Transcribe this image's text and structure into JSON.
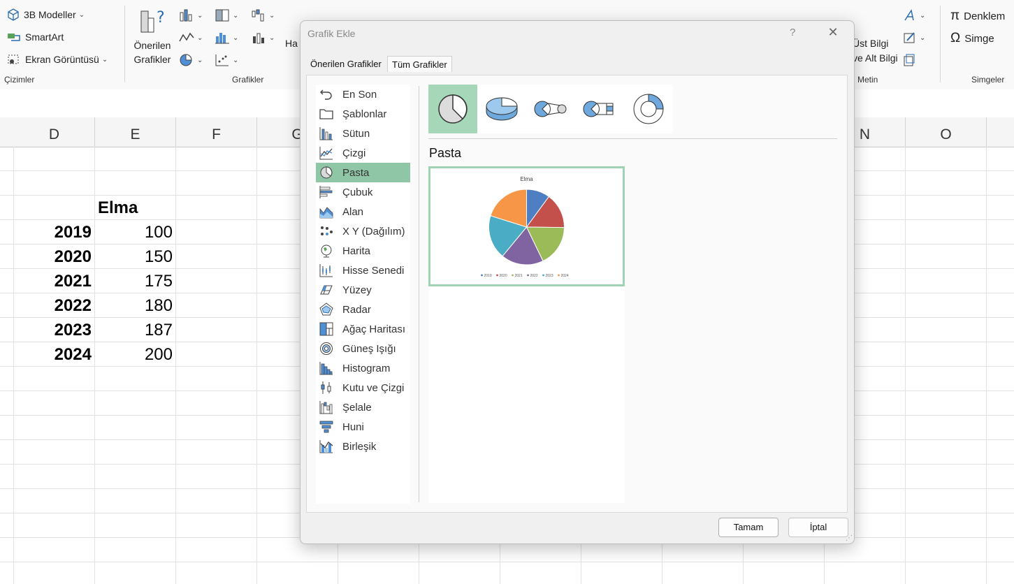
{
  "ribbon": {
    "models_3d": "3B Modeller",
    "smartart": "SmartArt",
    "screenshot": "Ekran Görüntüsü",
    "group_drawings": "Çizimler",
    "recommended_l1": "Önerilen",
    "recommended_l2": "Grafikler",
    "group_charts": "Grafikler",
    "map_partial": "Ha",
    "header_l1": "Üst Bilgi",
    "header_l2": "ve Alt Bilgi",
    "group_text": "Metin",
    "equation": "Denklem",
    "symbol": "Simge",
    "group_symbols": "Simgeler"
  },
  "sheet": {
    "columns": [
      "D",
      "E",
      "F",
      "G",
      "N",
      "O"
    ],
    "header_label": "Elma",
    "rows": [
      {
        "year": "2019",
        "value": "100"
      },
      {
        "year": "2020",
        "value": "150"
      },
      {
        "year": "2021",
        "value": "175"
      },
      {
        "year": "2022",
        "value": "180"
      },
      {
        "year": "2023",
        "value": "187"
      },
      {
        "year": "2024",
        "value": "200"
      }
    ]
  },
  "dialog": {
    "title": "Grafik Ekle",
    "help": "?",
    "close": "✕",
    "tabs": [
      {
        "label": "Önerilen Grafikler"
      },
      {
        "label": "Tüm Grafikler"
      }
    ],
    "chart_types": [
      {
        "label": "En Son"
      },
      {
        "label": "Şablonlar"
      },
      {
        "label": "Sütun"
      },
      {
        "label": "Çizgi"
      },
      {
        "label": "Pasta"
      },
      {
        "label": "Çubuk"
      },
      {
        "label": "Alan"
      },
      {
        "label": "X Y (Dağılım)"
      },
      {
        "label": "Harita"
      },
      {
        "label": "Hisse Senedi"
      },
      {
        "label": "Yüzey"
      },
      {
        "label": "Radar"
      },
      {
        "label": "Ağaç Haritası"
      },
      {
        "label": "Güneş Işığı"
      },
      {
        "label": "Histogram"
      },
      {
        "label": "Kutu ve Çizgi"
      },
      {
        "label": "Şelale"
      },
      {
        "label": "Huni"
      },
      {
        "label": "Birleşik"
      }
    ],
    "selected_type": "Pasta",
    "heading": "Pasta",
    "ok": "Tamam",
    "cancel": "İptal"
  },
  "chart_data": {
    "type": "pie",
    "title": "Elma",
    "categories": [
      "2019",
      "2020",
      "2021",
      "2022",
      "2023",
      "2024"
    ],
    "values": [
      100,
      150,
      175,
      180,
      187,
      200
    ],
    "colors": [
      "#4e7fc2",
      "#c4504c",
      "#9bbb59",
      "#8064a2",
      "#4bacc6",
      "#f79646"
    ],
    "legend": "bottom"
  }
}
